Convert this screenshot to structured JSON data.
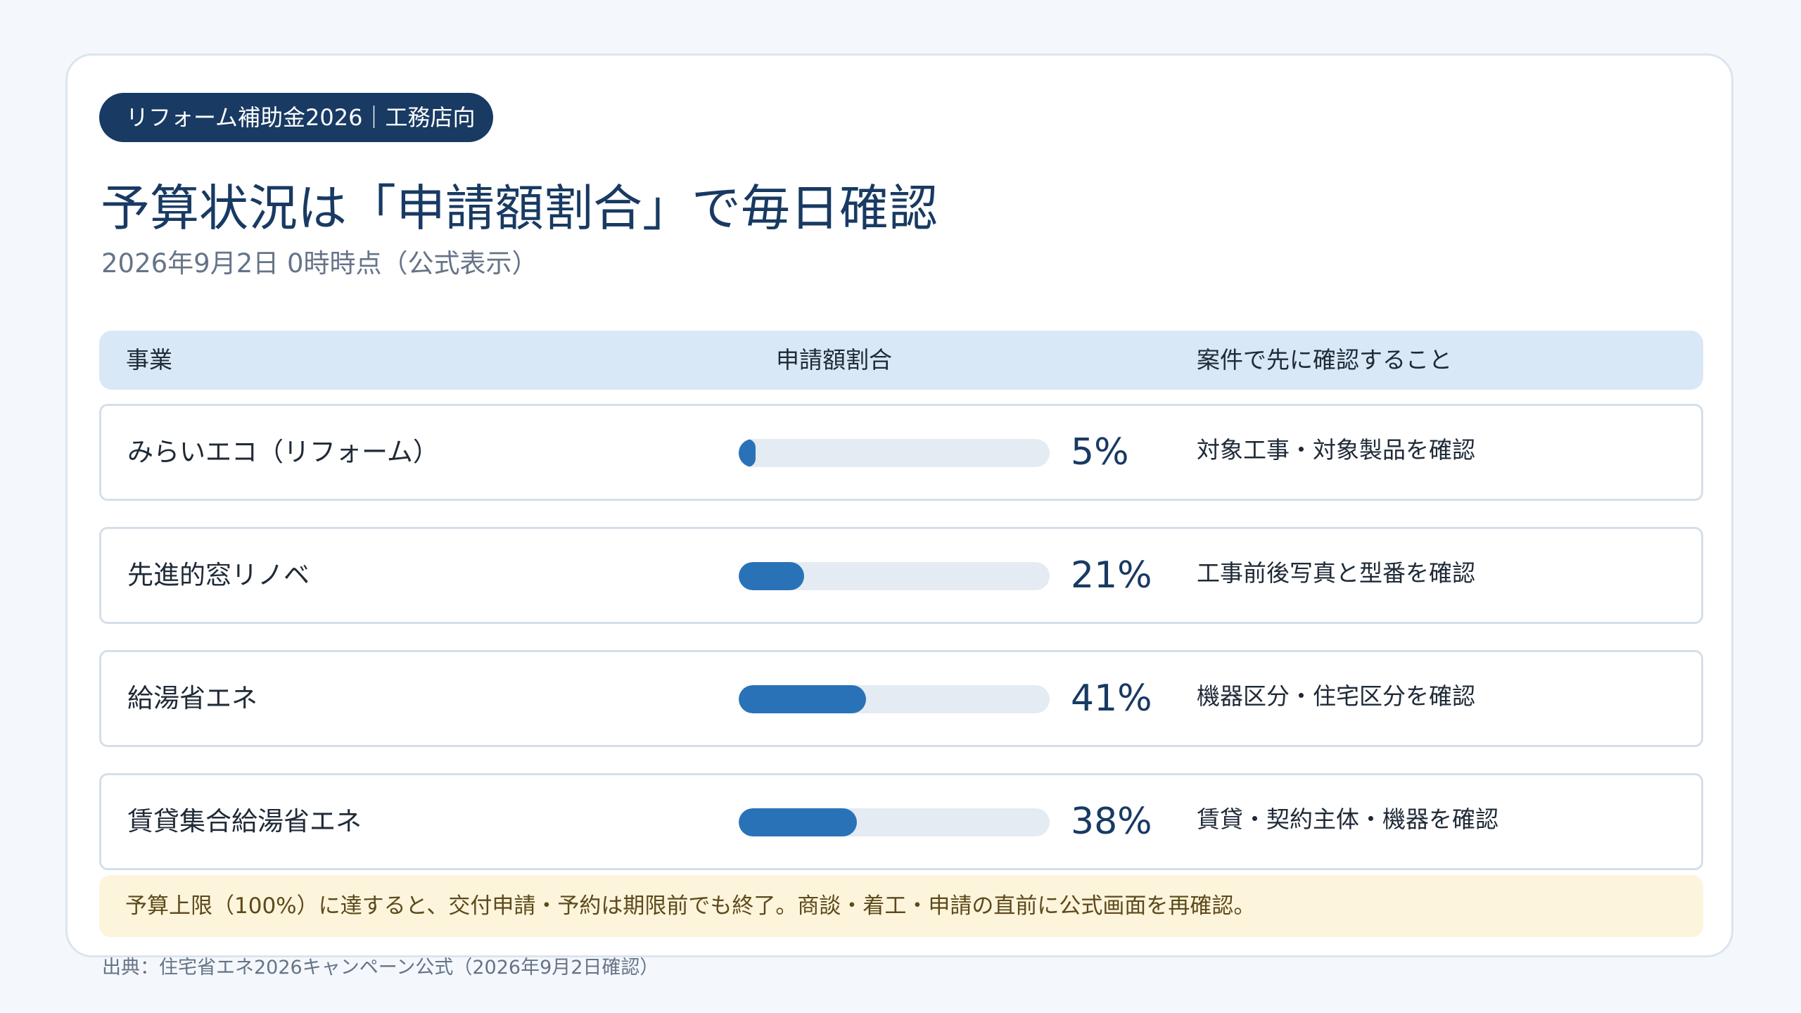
{
  "badge": "リフォーム補助金2026｜工務店向",
  "title": "予算状況は「申請額割合」で毎日確認",
  "subtitle": "2026年9月2日 0時時点（公式表示）",
  "table": {
    "headers": [
      "事業",
      "申請額割合",
      "案件で先に確認すること"
    ],
    "rows": [
      {
        "name": "みらいエコ（リフォーム）",
        "percent": 5,
        "percent_label": "5%",
        "check": "対象工事・対象製品を確認"
      },
      {
        "name": "先進的窓リノベ",
        "percent": 21,
        "percent_label": "21%",
        "check": "工事前後写真と型番を確認"
      },
      {
        "name": "給湯省エネ",
        "percent": 41,
        "percent_label": "41%",
        "check": "機器区分・住宅区分を確認"
      },
      {
        "name": "賃貸集合給湯省エネ",
        "percent": 38,
        "percent_label": "38%",
        "check": "賃貸・契約主体・機器を確認"
      }
    ]
  },
  "note": "予算上限（100%）に達すると、交付申請・予約は期限前でも終了。商談・着工・申請の直前に公式画面を再確認。",
  "source": "出典：住宅省エネ2026キャンペーン公式（2026年9月2日確認）",
  "colors": {
    "navy": "#183a63",
    "bar_fill": "#2a72b8",
    "bar_track": "#e4ebf2",
    "header_bg": "#d8e8f7",
    "note_bg": "#fdf4dc"
  }
}
